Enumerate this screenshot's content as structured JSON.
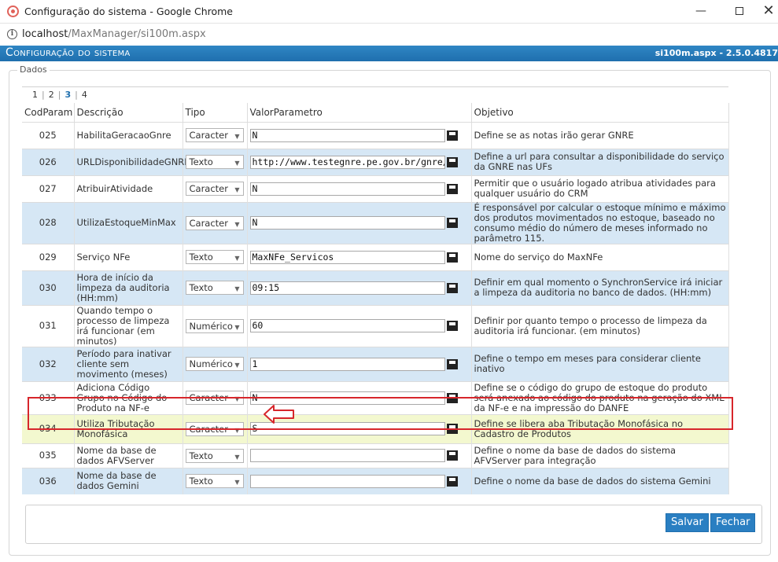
{
  "window": {
    "title": "Configuração do sistema - Google Chrome",
    "minimize": "—",
    "close": "✕"
  },
  "address": {
    "host": "localhost",
    "path": "/MaxManager/si100m.aspx"
  },
  "app": {
    "title": "Configuração do sistema",
    "version": "si100m.aspx - 2.5.0.4817"
  },
  "fieldset": {
    "legend": "Dados"
  },
  "pager": {
    "pages": [
      "1",
      "2",
      "3",
      "4"
    ],
    "current": "3"
  },
  "grid": {
    "headers": [
      "CodParam",
      "Descrição",
      "Tipo",
      "ValorParametro",
      "Objetivo"
    ],
    "rows": [
      {
        "code": "025",
        "desc": "HabilitaGeracaoGnre",
        "type": "Caracter",
        "value": "N",
        "obj": "Define se as notas irão gerar GNRE"
      },
      {
        "code": "026",
        "desc": "URLDisponibilidadeGNRE",
        "type": "Texto",
        "value": "http://www.testegnre.pe.gov.br/gnre/portal/c",
        "obj": "Define a url para consultar a disponibilidade do serviço da GNRE nas UFs"
      },
      {
        "code": "027",
        "desc": "AtribuirAtividade",
        "type": "Caracter",
        "value": "N",
        "obj": "Permitir que o usuário logado atribua atividades para qualquer usuário do CRM"
      },
      {
        "code": "028",
        "desc": "UtilizaEstoqueMinMax",
        "type": "Caracter",
        "value": "N",
        "obj": "É responsável por calcular o estoque mínimo e máximo dos produtos movimentados no estoque, baseado no consumo médio do número de meses informado no parâmetro 115."
      },
      {
        "code": "029",
        "desc": "Serviço NFe",
        "type": "Texto",
        "value": "MaxNFe_Servicos",
        "obj": "Nome do serviço do MaxNFe"
      },
      {
        "code": "030",
        "desc": "Hora de início da limpeza da auditoria (HH:mm)",
        "type": "Texto",
        "value": "09:15",
        "obj": "Definir em qual momento o SynchronService irá iniciar a limpeza da auditoria no banco de dados. (HH:mm)"
      },
      {
        "code": "031",
        "desc": "Quando tempo o processo de limpeza irá funcionar (em minutos)",
        "type": "Numérico",
        "value": "60",
        "obj": "Definir por quanto tempo o processo de limpeza da auditoria irá funcionar. (em minutos)"
      },
      {
        "code": "032",
        "desc": "Período para inativar cliente sem movimento (meses)",
        "type": "Numérico",
        "value": "1",
        "obj": "Define o tempo em meses para considerar cliente inativo"
      },
      {
        "code": "033",
        "desc": "Adiciona Código Grupo no Código do Produto na NF-e",
        "type": "Caracter",
        "value": "N",
        "obj": "Define se o código do grupo de estoque do produto será anexado ao código do produto na geração do XML da NF-e e na impressão do DANFE"
      },
      {
        "code": "034",
        "desc": "Utiliza Tributação Monofásica",
        "type": "Caracter",
        "value": "S",
        "obj": "Define se libera aba Tributação Monofásica no Cadastro de Produtos"
      },
      {
        "code": "035",
        "desc": "Nome da base de dados AFVServer",
        "type": "Texto",
        "value": "",
        "obj": "Define o nome da base de dados do sistema AFVServer para integração"
      },
      {
        "code": "036",
        "desc": "Nome da base de dados Gemini",
        "type": "Texto",
        "value": "",
        "obj": "Define o nome da base de dados do sistema Gemini"
      }
    ]
  },
  "buttons": {
    "save": "Salvar",
    "close": "Fechar"
  },
  "colors": {
    "header": "#1f6fae",
    "row_alt": "#d6e7f5",
    "row_highlight": "#f3f8cf",
    "annotation": "#d7262b"
  }
}
